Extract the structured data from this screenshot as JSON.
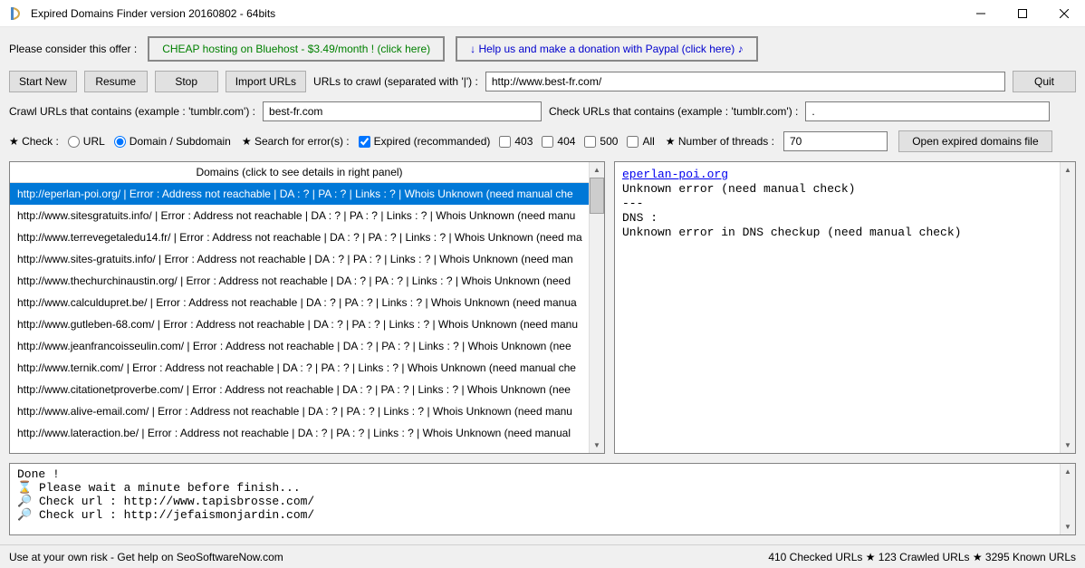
{
  "title": "Expired Domains Finder version 20160802 - 64bits",
  "offer": {
    "label": "Please consider this offer :",
    "hosting": "CHEAP hosting on Bluehost - $3.49/month ! (click here)",
    "paypal": "↓ Help us and make a donation with Paypal (click here) ♪"
  },
  "toolbar": {
    "start": "Start New",
    "resume": "Resume",
    "stop": "Stop",
    "import": "Import URLs",
    "urls_label": "URLs to crawl (separated with '|') :",
    "urls_value": "http://www.best-fr.com/",
    "quit": "Quit"
  },
  "filters": {
    "crawl_label": "Crawl URLs that contains (example : 'tumblr.com') :",
    "crawl_value": "best-fr.com",
    "check_label": "Check URLs that contains (example : 'tumblr.com') :",
    "check_value": "."
  },
  "options": {
    "check_label": "★ Check :",
    "url": "URL",
    "domain": "Domain / Subdomain",
    "search_label": "★ Search for error(s) :",
    "expired": "Expired (recommanded)",
    "e403": "403",
    "e404": "404",
    "e500": "500",
    "all": "All",
    "threads_label": "★ Number of threads :",
    "threads_value": "70",
    "open_file": "Open expired domains file"
  },
  "domains": {
    "header": "Domains (click to see details in right panel)",
    "items": [
      "http://eperlan-poi.org/ | Error : Address not reachable | DA : ? | PA : ? | Links : ? | Whois Unknown (need manual che",
      "http://www.sitesgratuits.info/ | Error : Address not reachable | DA : ? | PA : ? | Links : ? | Whois Unknown (need manu",
      "http://www.terrevegetaledu14.fr/ | Error : Address not reachable | DA : ? | PA : ? | Links : ? | Whois Unknown (need ma",
      "http://www.sites-gratuits.info/ | Error : Address not reachable | DA : ? | PA : ? | Links : ? | Whois Unknown (need man",
      "http://www.thechurchinaustin.org/ | Error : Address not reachable | DA : ? | PA : ? | Links : ? | Whois Unknown (need",
      "http://www.calculdupret.be/ | Error : Address not reachable | DA : ? | PA : ? | Links : ? | Whois Unknown (need manua",
      "http://www.gutleben-68.com/ | Error : Address not reachable | DA : ? | PA : ? | Links : ? | Whois Unknown (need manu",
      "http://www.jeanfrancoisseulin.com/ | Error : Address not reachable | DA : ? | PA : ? | Links : ? | Whois Unknown (nee",
      "http://www.ternik.com/ | Error : Address not reachable | DA : ? | PA : ? | Links : ? | Whois Unknown (need manual che",
      "http://www.citationetproverbe.com/ | Error : Address not reachable | DA : ? | PA : ? | Links : ? | Whois Unknown (nee",
      "http://www.alive-email.com/ | Error : Address not reachable | DA : ? | PA : ? | Links : ? | Whois Unknown (need manu",
      "http://www.lateraction.be/ | Error : Address not reachable | DA : ? | PA : ? | Links : ? | Whois Unknown (need manual"
    ]
  },
  "details": {
    "link": "eperlan-poi.org",
    "lines": "Unknown error (need manual check)\n---\nDNS :\nUnknown error in DNS checkup (need manual check)"
  },
  "log": "Done !\n⌛ Please wait a minute before finish...\n🔎 Check url : http://www.tapisbrosse.com/\n🔎 Check url : http://jefaismonjardin.com/",
  "status": {
    "left": "Use at your own risk - Get help on SeoSoftwareNow.com",
    "right": "410 Checked URLs ★ 123 Crawled URLs ★ 3295 Known URLs"
  }
}
